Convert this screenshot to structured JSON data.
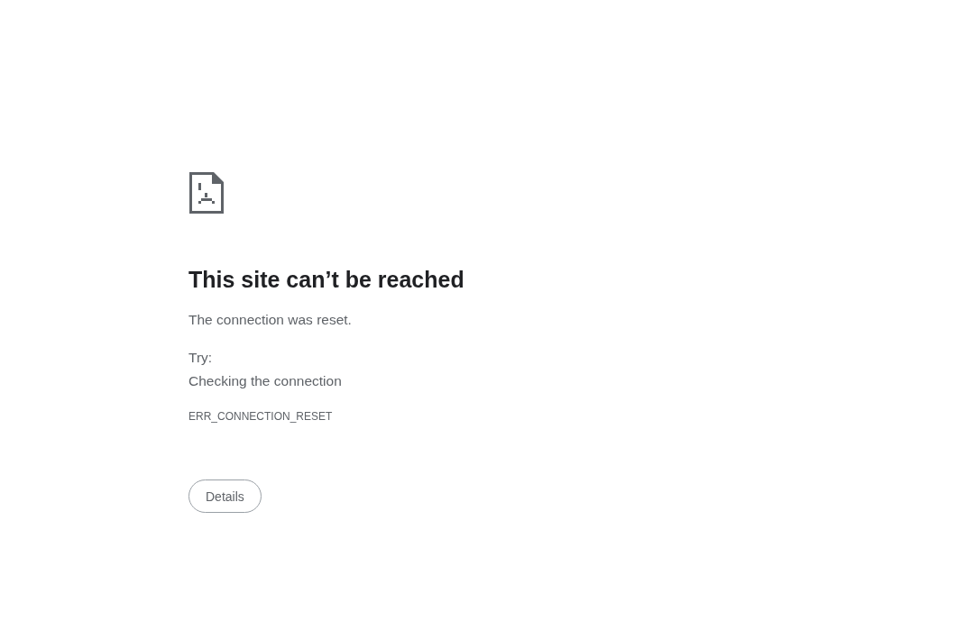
{
  "heading": "This site can’t be reached",
  "message": "The connection was reset.",
  "try_label": "Try:",
  "suggestions": [
    "Checking the connection"
  ],
  "error_code": "ERR_CONNECTION_RESET",
  "details_button": "Details"
}
